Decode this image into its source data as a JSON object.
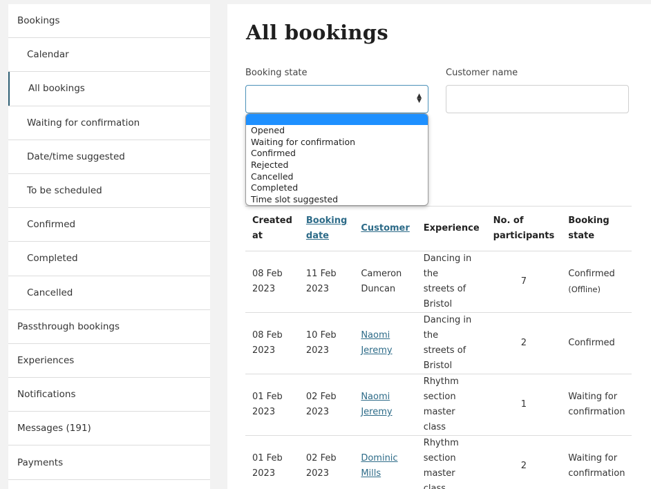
{
  "sidebar": {
    "items": [
      {
        "label": "Bookings"
      },
      {
        "label": "Calendar"
      },
      {
        "label": "All bookings"
      },
      {
        "label": "Waiting for confirmation"
      },
      {
        "label": "Date/time suggested"
      },
      {
        "label": "To be scheduled"
      },
      {
        "label": "Confirmed"
      },
      {
        "label": "Completed"
      },
      {
        "label": "Cancelled"
      },
      {
        "label": "Passthrough bookings"
      },
      {
        "label": "Experiences"
      },
      {
        "label": "Notifications"
      },
      {
        "label": "Messages (191)"
      },
      {
        "label": "Payments"
      }
    ]
  },
  "main": {
    "title": "All bookings",
    "filters": {
      "booking_state_label": "Booking state",
      "booking_state_value": "",
      "customer_name_label": "Customer name",
      "customer_name_value": "",
      "options": [
        "Opened",
        "Waiting for confirmation",
        "Confirmed",
        "Rejected",
        "Cancelled",
        "Completed",
        "Time slot suggested"
      ]
    },
    "table": {
      "headers": {
        "created_at": [
          "Created",
          "at"
        ],
        "booking_date": [
          "Booking",
          "date"
        ],
        "customer": "Customer",
        "experience": "Experience",
        "participants": [
          "No. of",
          "participants"
        ],
        "state": [
          "Booking",
          "state"
        ]
      },
      "rows": [
        {
          "created": [
            "08 Feb",
            "2023"
          ],
          "booking_date": "11 Feb 2023",
          "customer": [
            "Cameron",
            "Duncan"
          ],
          "experience": [
            "Dancing in the",
            "streets of",
            "Bristol"
          ],
          "participants": "7",
          "state": [
            "Confirmed",
            "(Offline)"
          ]
        },
        {
          "created": [
            "08 Feb",
            "2023"
          ],
          "booking_date": "10 Feb 2023",
          "customer": [
            "Naomi",
            "Jeremy"
          ],
          "experience": [
            "Dancing in the",
            "streets of",
            "Bristol"
          ],
          "participants": "2",
          "state": [
            "Confirmed",
            ""
          ]
        },
        {
          "created": [
            "01 Feb",
            "2023"
          ],
          "booking_date": "02 Feb 2023",
          "customer": [
            "Naomi",
            "Jeremy"
          ],
          "experience": [
            "Rhythm",
            "section",
            "master class"
          ],
          "participants": "1",
          "state": [
            "Waiting for",
            "confirmation"
          ]
        },
        {
          "created": [
            "01 Feb",
            "2023"
          ],
          "booking_date": "02 Feb 2023",
          "customer": [
            "Dominic",
            "Mills"
          ],
          "experience": [
            "Rhythm",
            "section",
            "master class"
          ],
          "participants": "2",
          "state": [
            "Waiting for",
            "confirmation"
          ]
        }
      ]
    }
  },
  "colors": {
    "accent": "#2d6b88",
    "highlight": "#1e90ff",
    "page_bg": "#f2f2f2"
  }
}
